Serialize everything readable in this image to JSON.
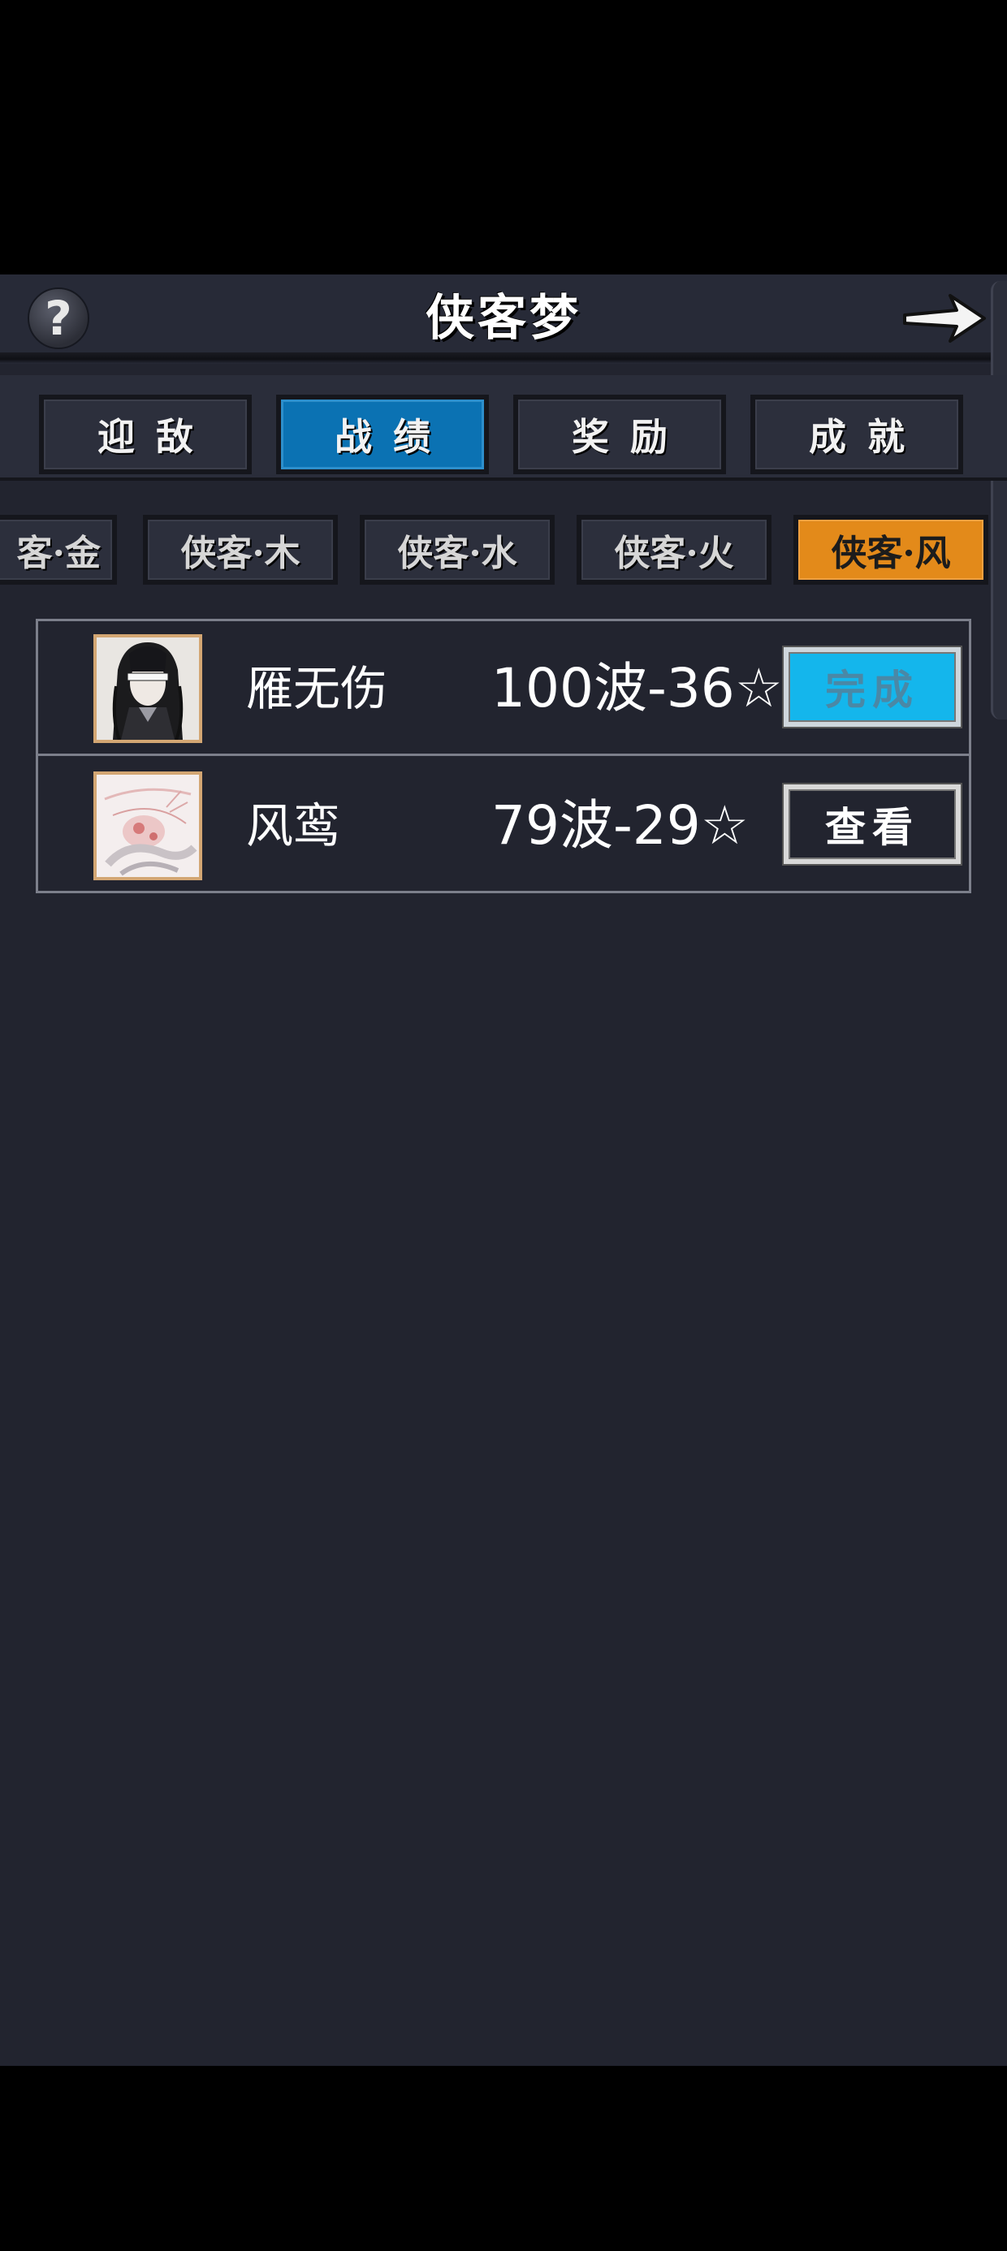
{
  "header": {
    "title": "侠客梦",
    "help_label": "?",
    "icons": [
      "question-icon",
      "arrow-right-icon"
    ]
  },
  "main_tabs": [
    {
      "label": "迎敌",
      "active": false
    },
    {
      "label": "战绩",
      "active": true
    },
    {
      "label": "奖励",
      "active": false
    },
    {
      "label": "成就",
      "active": false
    }
  ],
  "sub_tabs": [
    {
      "label": "客·金",
      "active": false
    },
    {
      "label": "侠客·木",
      "active": false
    },
    {
      "label": "侠客·水",
      "active": false
    },
    {
      "label": "侠客·火",
      "active": false
    },
    {
      "label": "侠客·风",
      "active": true
    }
  ],
  "records": [
    {
      "name": "雁无伤",
      "record": "100波-36☆",
      "action": "完成",
      "action_state": "completed"
    },
    {
      "name": "风鸾",
      "record": "79波-29☆",
      "action": "查看",
      "action_state": "view"
    }
  ],
  "colors": {
    "background": "#22242f",
    "active_main_tab": "#0b72b3",
    "active_sub_tab": "#e38a1a",
    "done_button": "#14b6ec",
    "avatar_border": "#d3a673"
  }
}
